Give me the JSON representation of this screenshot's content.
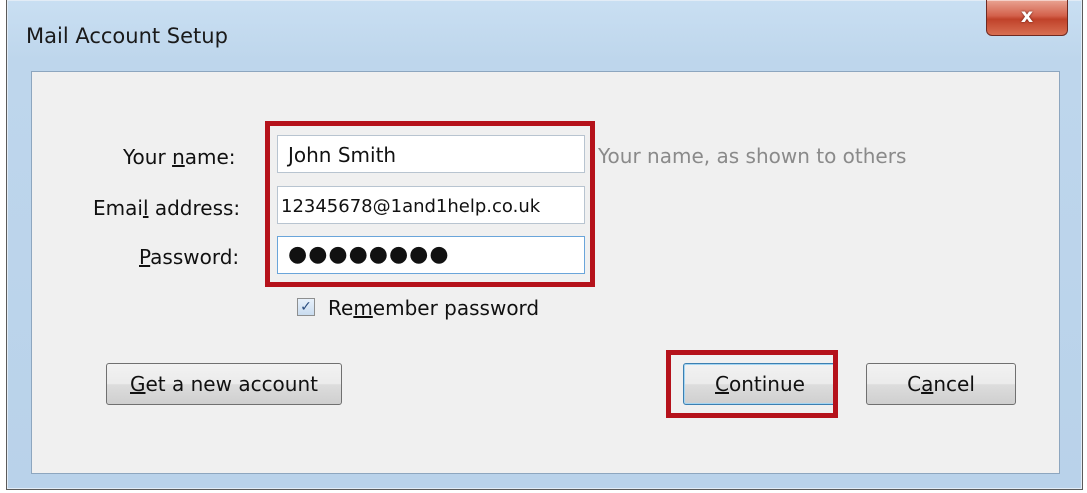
{
  "window": {
    "title": "Mail Account Setup",
    "close_label": "x"
  },
  "form": {
    "name": {
      "label_pre": "Your ",
      "label_access": "n",
      "label_post": "ame:",
      "value": "John Smith",
      "hint": "Your name, as shown to others"
    },
    "email": {
      "label_pre": "Emai",
      "label_access": "l",
      "label_post": " address:",
      "value": "12345678@1and1help.co.uk"
    },
    "password": {
      "label_pre": "",
      "label_access": "P",
      "label_post": "assword:",
      "value": "●●●●●●●●"
    },
    "remember": {
      "checked": true,
      "check_glyph": "✓",
      "label_pre": "Re",
      "label_access": "m",
      "label_post": "ember password"
    }
  },
  "buttons": {
    "new_account": {
      "pre": "",
      "access": "G",
      "post": "et a new account"
    },
    "continue": {
      "pre": "",
      "access": "C",
      "post": "ontinue"
    },
    "cancel": {
      "pre": "C",
      "access": "a",
      "post": "ncel"
    }
  },
  "colors": {
    "highlight": "#b5121b",
    "close_button": "#c0422a",
    "hint_text": "#8a8a8a"
  }
}
